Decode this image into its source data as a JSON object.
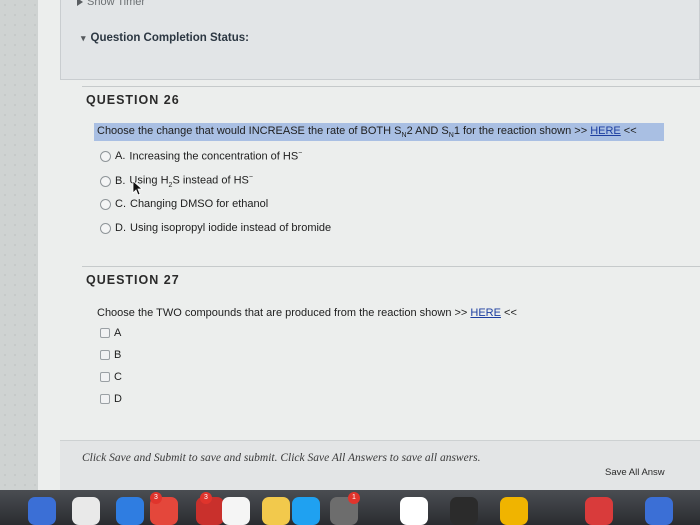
{
  "timer": {
    "label": "Show Timer"
  },
  "completion": {
    "label": "Question Completion Status:"
  },
  "q26": {
    "title": "QUESTION 26",
    "prompt_pre": "Choose the change that would INCREASE the rate of BOTH S",
    "prompt_sub1": "N",
    "prompt_mid1": "2 AND S",
    "prompt_sub2": "N",
    "prompt_mid2": "1 for the reaction shown >> ",
    "prompt_link": "HERE",
    "prompt_post": " <<",
    "options": [
      {
        "letter": "A.",
        "text": "Increasing the concentration of HS",
        "sup": "−"
      },
      {
        "letter": "B.",
        "text_pre": "Using H",
        "sub": "2",
        "text_post": "S instead of HS",
        "sup": "−"
      },
      {
        "letter": "C.",
        "text": "Changing DMSO for ethanol"
      },
      {
        "letter": "D.",
        "text": "Using isopropyl iodide instead of bromide"
      }
    ]
  },
  "q27": {
    "title": "QUESTION 27",
    "prompt_pre": "Choose the TWO compounds that are produced from the reaction shown >> ",
    "prompt_link": "HERE",
    "prompt_post": " <<",
    "options": [
      "A",
      "B",
      "C",
      "D"
    ]
  },
  "footer": {
    "instruction": "Click Save and Submit to save and submit. Click Save All Answers to save all answers.",
    "save_all": "Save All Answ"
  },
  "dock": {
    "badges": [
      "3",
      "3",
      "1"
    ],
    "colors": [
      "#3b6fd6",
      "#e9e9e9",
      "#2f7de1",
      "#e4473b",
      "#c9302c",
      "#f5f5f5",
      "#f2c94c",
      "#1fa1f1",
      "#6d6d6d",
      "#e23b32",
      "#ffffff",
      "#2b2b2b",
      "#f0b400",
      "#d93b3b"
    ]
  }
}
